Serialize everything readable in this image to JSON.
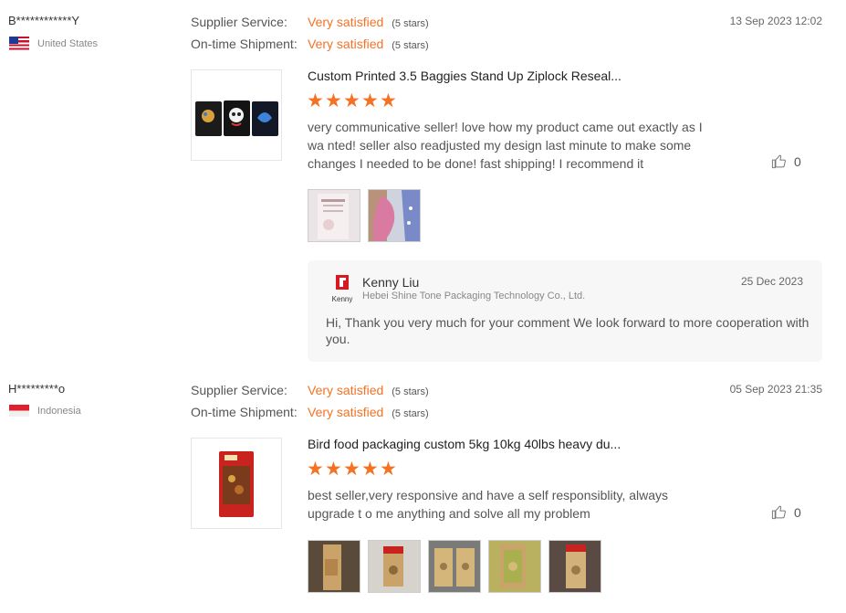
{
  "reviews": [
    {
      "buyer": "B************Y",
      "country": "United States",
      "flag": "us-flag",
      "date": "13 Sep 2023 12:02",
      "ratings": [
        {
          "label": "Supplier Service:",
          "value": "Very satisfied",
          "stars": "(5 stars)"
        },
        {
          "label": "On-time Shipment:",
          "value": "Very satisfied",
          "stars": "(5 stars)"
        }
      ],
      "product_title": "Custom Printed 3.5 Baggies Stand Up Ziplock Reseal...",
      "product_rating": 5,
      "comment": "very communicative seller! love how my product came out exactly as I wa nted! seller also readjusted my design last minute to make some changes I needed to be done! fast shipping! I recommend it",
      "likes": "0",
      "photos": 2,
      "reply": {
        "logo_text": "Kenny",
        "name": "Kenny Liu",
        "company": "Hebei Shine Tone Packaging Technology Co., Ltd.",
        "date": "25 Dec 2023",
        "text": "Hi, Thank you very much for your comment We look forward to more cooperation with you."
      }
    },
    {
      "buyer": "H*********o",
      "country": "Indonesia",
      "flag": "id-flag",
      "date": "05 Sep 2023 21:35",
      "ratings": [
        {
          "label": "Supplier Service:",
          "value": "Very satisfied",
          "stars": "(5 stars)"
        },
        {
          "label": "On-time Shipment:",
          "value": "Very satisfied",
          "stars": "(5 stars)"
        }
      ],
      "product_title": "Bird food packaging custom 5kg 10kg 40lbs heavy du...",
      "product_rating": 5,
      "comment": "best seller,very responsive and have a self responsiblity, always upgrade t o me anything and solve all my problem",
      "likes": "0",
      "photos": 5
    }
  ],
  "colors": {
    "accent": "#f57224",
    "reply_bg": "#f7f7f7",
    "logo_red": "#d71920"
  },
  "icons": {
    "like": "thumbs-up-icon",
    "star": "star-icon"
  }
}
